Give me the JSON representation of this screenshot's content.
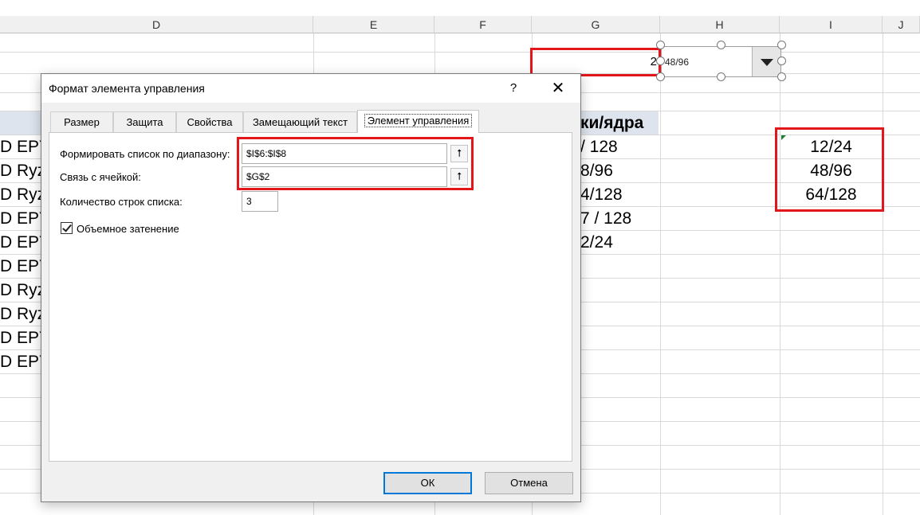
{
  "sheet": {
    "columns": [
      "D",
      "E",
      "F",
      "G",
      "H",
      "I",
      "J"
    ],
    "g2_value": "2",
    "combo_value": "48/96",
    "g5_header": "ки/ядра",
    "col_d_rows": [
      "D EPY",
      "D Ryz",
      "D Ryz",
      "D EPY",
      "D EPY",
      "D EPY",
      "D Ryz",
      "D Ryz",
      "D EPY",
      "D EPY"
    ],
    "col_g_rows": [
      "/ 128",
      "8/96",
      "4/128",
      "7 / 128",
      "2/24"
    ],
    "col_i_rows": [
      "12/24",
      "48/96",
      "64/128"
    ]
  },
  "dialog": {
    "title": "Формат элемента управления",
    "help": "?",
    "close": "✕",
    "tabs": [
      "Размер",
      "Защита",
      "Свойства",
      "Замещающий текст",
      "Элемент управления"
    ],
    "input_range_label": "Формировать список по диапазону:",
    "input_range_value": "$I$6:$I$8",
    "cell_link_label": "Связь с ячейкой:",
    "cell_link_value": "$G$2",
    "drop_lines_label": "Количество строк списка:",
    "drop_lines_value": "3",
    "shading_label": "Объемное затенение",
    "ok": "ОК",
    "cancel": "Отмена",
    "ref_icon": "collapse-dialog-icon"
  },
  "colors": {
    "highlight_red": "#e3161c",
    "header_fill": "#dde4ee",
    "default_button_border": "#0078d7"
  }
}
